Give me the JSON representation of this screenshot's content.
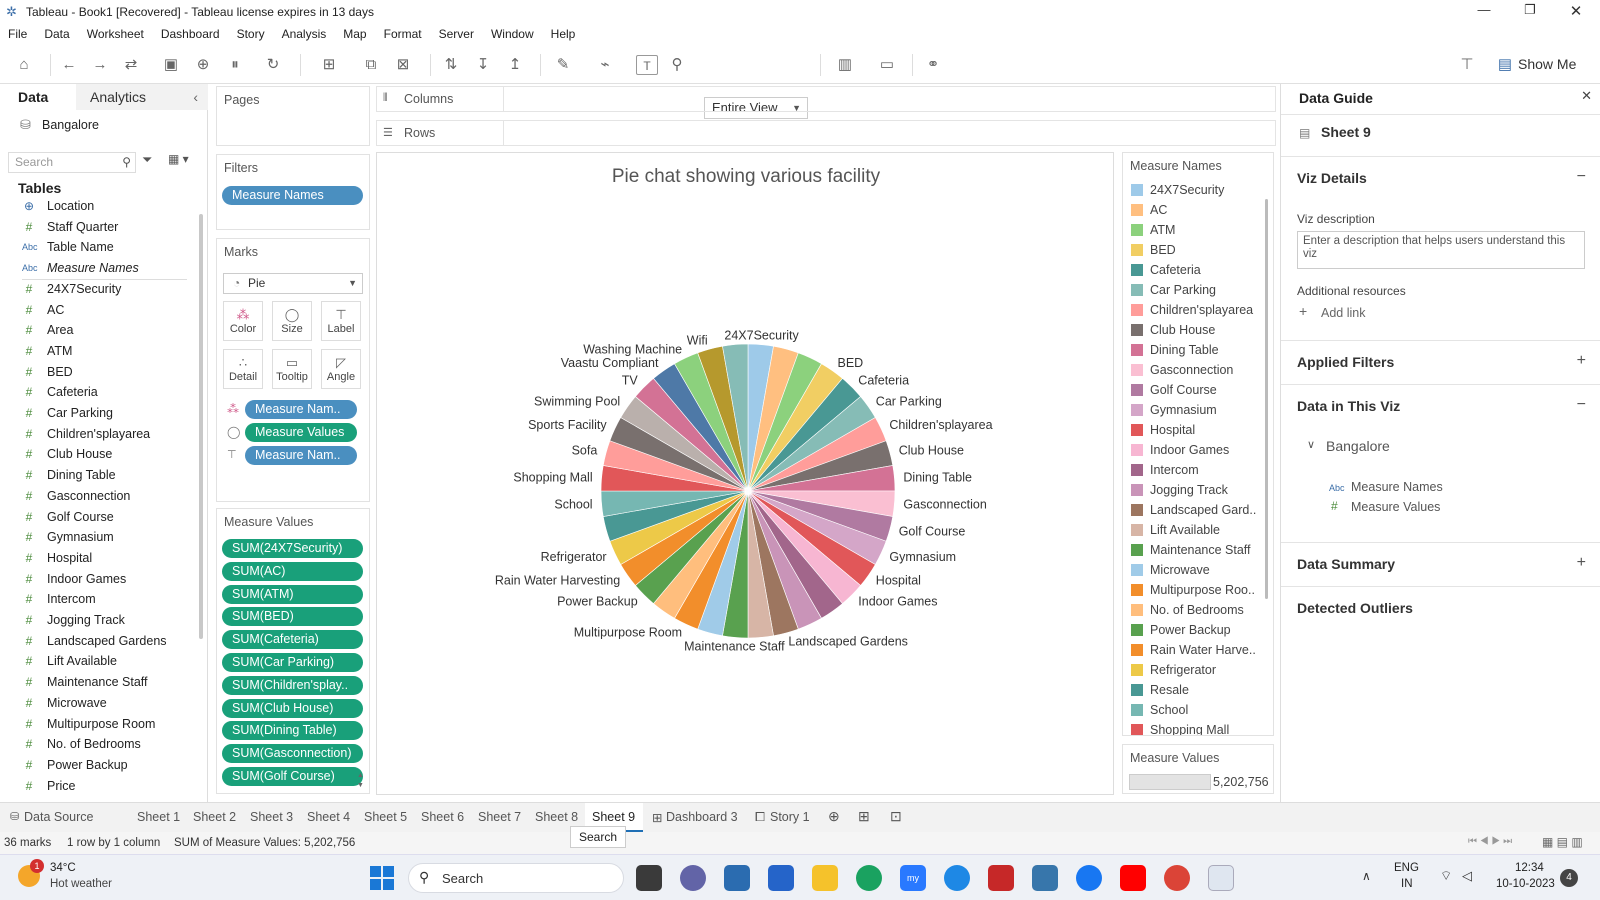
{
  "window": {
    "title": "Tableau - Book1 [Recovered] - Tableau license expires in 13 days"
  },
  "menu": [
    "File",
    "Data",
    "Worksheet",
    "Dashboard",
    "Story",
    "Analysis",
    "Map",
    "Format",
    "Server",
    "Window",
    "Help"
  ],
  "toolbar": {
    "view_select": "Entire View",
    "show_me": "Show Me"
  },
  "left_pane": {
    "tab_data": "Data",
    "tab_analytics": "Analytics",
    "datasource": "Bangalore",
    "search_placeholder": "Search",
    "tables_label": "Tables",
    "fields": [
      {
        "type": "geo",
        "name": "Location"
      },
      {
        "type": "num",
        "name": "Staff Quarter"
      },
      {
        "type": "abc",
        "name": "Table Name"
      },
      {
        "type": "abc",
        "name": "Measure Names"
      },
      {
        "type": "num",
        "name": "24X7Security"
      },
      {
        "type": "num",
        "name": "AC"
      },
      {
        "type": "num",
        "name": "Area"
      },
      {
        "type": "num",
        "name": "ATM"
      },
      {
        "type": "num",
        "name": "BED"
      },
      {
        "type": "num",
        "name": "Cafeteria"
      },
      {
        "type": "num",
        "name": "Car Parking"
      },
      {
        "type": "num",
        "name": "Children'splayarea"
      },
      {
        "type": "num",
        "name": "Club House"
      },
      {
        "type": "num",
        "name": "Dining Table"
      },
      {
        "type": "num",
        "name": "Gasconnection"
      },
      {
        "type": "num",
        "name": "Golf Course"
      },
      {
        "type": "num",
        "name": "Gymnasium"
      },
      {
        "type": "num",
        "name": "Hospital"
      },
      {
        "type": "num",
        "name": "Indoor Games"
      },
      {
        "type": "num",
        "name": "Intercom"
      },
      {
        "type": "num",
        "name": "Jogging Track"
      },
      {
        "type": "num",
        "name": "Landscaped Gardens"
      },
      {
        "type": "num",
        "name": "Lift Available"
      },
      {
        "type": "num",
        "name": "Maintenance Staff"
      },
      {
        "type": "num",
        "name": "Microwave"
      },
      {
        "type": "num",
        "name": "Multipurpose Room"
      },
      {
        "type": "num",
        "name": "No. of Bedrooms"
      },
      {
        "type": "num",
        "name": "Power Backup"
      },
      {
        "type": "num",
        "name": "Price"
      }
    ]
  },
  "shelves": {
    "pages": "Pages",
    "filters": "Filters",
    "filter_pill": "Measure Names",
    "marks": "Marks",
    "mark_type": "Pie",
    "mark_buttons": [
      "Color",
      "Size",
      "Label",
      "Detail",
      "Tooltip",
      "Angle"
    ],
    "mark_pills": [
      "Measure Nam..",
      "Measure Values",
      "Measure Nam.."
    ],
    "measure_values": "Measure Values",
    "mv_pills": [
      "SUM(24X7Security)",
      "SUM(AC)",
      "SUM(ATM)",
      "SUM(BED)",
      "SUM(Cafeteria)",
      "SUM(Car Parking)",
      "SUM(Children'splay..",
      "SUM(Club House)",
      "SUM(Dining Table)",
      "SUM(Gasconnection)",
      "SUM(Golf Course)"
    ],
    "columns": "Columns",
    "rows": "Rows"
  },
  "chart_data": {
    "type": "pie",
    "title": "Pie chat showing various facility",
    "slices": [
      {
        "name": "24X7Security",
        "color": "#9ecae9",
        "label": true
      },
      {
        "name": "AC",
        "color": "#ffbf80",
        "label": false
      },
      {
        "name": "ATM",
        "color": "#8cd17d",
        "label": false
      },
      {
        "name": "BED",
        "color": "#f1ce63",
        "label": true
      },
      {
        "name": "Cafeteria",
        "color": "#499894",
        "label": true
      },
      {
        "name": "Car Parking",
        "color": "#86bcb6",
        "label": true
      },
      {
        "name": "Children'splayarea",
        "color": "#ff9d9a",
        "label": true
      },
      {
        "name": "Club House",
        "color": "#79706e",
        "label": true
      },
      {
        "name": "Dining Table",
        "color": "#d37295",
        "label": true
      },
      {
        "name": "Gasconnection",
        "color": "#fabfd2",
        "label": true
      },
      {
        "name": "Golf Course",
        "color": "#b07aa1",
        "label": true
      },
      {
        "name": "Gymnasium",
        "color": "#d4a6c8",
        "label": true
      },
      {
        "name": "Hospital",
        "color": "#e15759",
        "label": true
      },
      {
        "name": "Indoor Games",
        "color": "#f7b6d2",
        "label": true
      },
      {
        "name": "Intercom",
        "color": "#a2668b",
        "label": false
      },
      {
        "name": "Jogging Track",
        "color": "#c994b8",
        "label": false
      },
      {
        "name": "Landscaped Gardens",
        "color": "#9d7660",
        "label": true
      },
      {
        "name": "Lift Available",
        "color": "#d7b5a6",
        "label": false
      },
      {
        "name": "Maintenance Staff",
        "color": "#59a14f",
        "label": true
      },
      {
        "name": "Microwave",
        "color": "#a0cbe8",
        "label": false
      },
      {
        "name": "Multipurpose Room",
        "color": "#f28e2b",
        "label": true
      },
      {
        "name": "No. of Bedrooms",
        "color": "#ffbe7d",
        "label": false
      },
      {
        "name": "Power Backup",
        "color": "#59a14f",
        "label": true
      },
      {
        "name": "Rain Water Harvesting",
        "color": "#f28e2b",
        "label": true
      },
      {
        "name": "Refrigerator",
        "color": "#edc948",
        "label": true
      },
      {
        "name": "Resale",
        "color": "#499894",
        "label": false
      },
      {
        "name": "School",
        "color": "#76b7b2",
        "label": true
      },
      {
        "name": "Shopping Mall",
        "color": "#e15759",
        "label": true
      },
      {
        "name": "Sofa",
        "color": "#ff9d9a",
        "label": true
      },
      {
        "name": "Sports Facility",
        "color": "#79706e",
        "label": true
      },
      {
        "name": "Swimming Pool",
        "color": "#bab0ac",
        "label": true
      },
      {
        "name": "TV",
        "color": "#d37295",
        "label": true
      },
      {
        "name": "Vaastu Compliant",
        "color": "#4e79a7",
        "label": true
      },
      {
        "name": "Washing Machine",
        "color": "#8cd17d",
        "label": true
      },
      {
        "name": "Wifi",
        "color": "#b6992d",
        "label": true
      },
      {
        "name": "Staff Quarter",
        "color": "#86bcb6",
        "label": false
      }
    ]
  },
  "legend": {
    "title": "Measure Names",
    "items": [
      "24X7Security",
      "AC",
      "ATM",
      "BED",
      "Cafeteria",
      "Car Parking",
      "Children'splayarea",
      "Club House",
      "Dining Table",
      "Gasconnection",
      "Golf Course",
      "Gymnasium",
      "Hospital",
      "Indoor Games",
      "Intercom",
      "Jogging Track",
      "Landscaped Gard..",
      "Lift Available",
      "Maintenance Staff",
      "Microwave",
      "Multipurpose Roo..",
      "No. of Bedrooms",
      "Power Backup",
      "Rain Water Harve..",
      "Refrigerator",
      "Resale",
      "School",
      "Shopping Mall"
    ],
    "size_title": "Measure Values",
    "size_value": "5,202,756"
  },
  "data_guide": {
    "title": "Data Guide",
    "sheet": "Sheet 9",
    "viz_details": "Viz Details",
    "viz_description_label": "Viz description",
    "viz_description_placeholder": "Enter a description that helps users understand this viz",
    "additional_resources": "Additional resources",
    "add_link": "Add link",
    "applied_filters": "Applied Filters",
    "data_in_viz": "Data in This Viz",
    "source": "Bangalore",
    "fields": [
      "Measure Names",
      "Measure Values"
    ],
    "data_summary": "Data Summary",
    "detected_outliers": "Detected Outliers"
  },
  "sheet_tabs": {
    "data_source": "Data Source",
    "tabs": [
      "Sheet 1",
      "Sheet 2",
      "Sheet 3",
      "Sheet 4",
      "Sheet 5",
      "Sheet 6",
      "Sheet 7",
      "Sheet 8",
      "Sheet 9"
    ],
    "active": "Sheet 9",
    "dashboard": "Dashboard 3",
    "story": "Story 1",
    "tooltip": "Search"
  },
  "status": {
    "marks": "36 marks",
    "layout": "1 row by 1 column",
    "sum": "SUM of Measure Values: 5,202,756"
  },
  "taskbar": {
    "temp": "34°C",
    "weather": "Hot weather",
    "search": "Search",
    "lang1": "ENG",
    "lang2": "IN",
    "time": "12:34",
    "date": "10-10-2023",
    "notif": "4",
    "weather_badge": "1"
  }
}
